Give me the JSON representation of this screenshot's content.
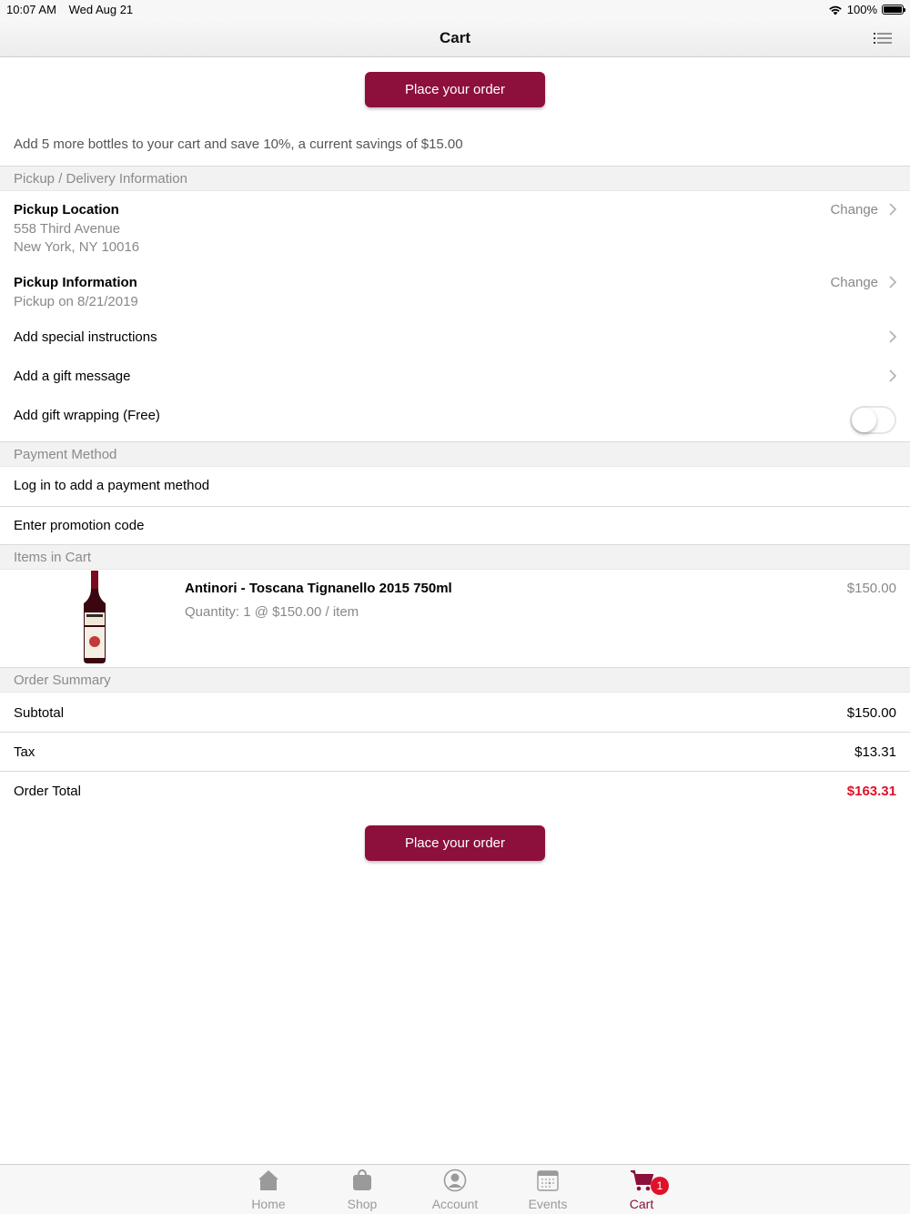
{
  "status_bar": {
    "time": "10:07 AM",
    "date": "Wed Aug 21",
    "battery": "100%"
  },
  "nav": {
    "title": "Cart",
    "menu_icon": "list-icon"
  },
  "order_button_label": "Place your order",
  "promo_message": "Add 5 more bottles to your cart and save 10%, a current savings of $15.00",
  "pickup_section": {
    "header": "Pickup / Delivery Information",
    "location_title": "Pickup Location",
    "location_line1": "558 Third Avenue",
    "location_line2": "New York, NY 10016",
    "info_title": "Pickup Information",
    "info_sub": "Pickup on 8/21/2019",
    "change_label": "Change",
    "special_instructions": "Add special instructions",
    "gift_message": "Add a gift message",
    "gift_wrapping": "Add gift wrapping (Free)",
    "gift_wrapping_on": false
  },
  "payment_section": {
    "header": "Payment Method",
    "login_prompt": "Log in to add a payment method",
    "promo_code": "Enter promotion code"
  },
  "cart_section": {
    "header": "Items in Cart",
    "items": [
      {
        "name": "Antinori - Toscana Tignanello 2015 750ml",
        "quantity_text": "Quantity: 1 @ $150.00 / item",
        "price": "$150.00"
      }
    ]
  },
  "summary_section": {
    "header": "Order Summary",
    "subtotal_label": "Subtotal",
    "subtotal": "$150.00",
    "tax_label": "Tax",
    "tax": "$13.31",
    "total_label": "Order Total",
    "total": "$163.31"
  },
  "tabs": [
    {
      "label": "Home",
      "icon": "home-icon"
    },
    {
      "label": "Shop",
      "icon": "shopping-bag-icon"
    },
    {
      "label": "Account",
      "icon": "account-icon"
    },
    {
      "label": "Events",
      "icon": "calendar-icon"
    },
    {
      "label": "Cart",
      "icon": "cart-icon",
      "badge": "1",
      "active": true
    }
  ],
  "colors": {
    "brand": "#8c0f3c",
    "total_red": "#e0112a"
  }
}
